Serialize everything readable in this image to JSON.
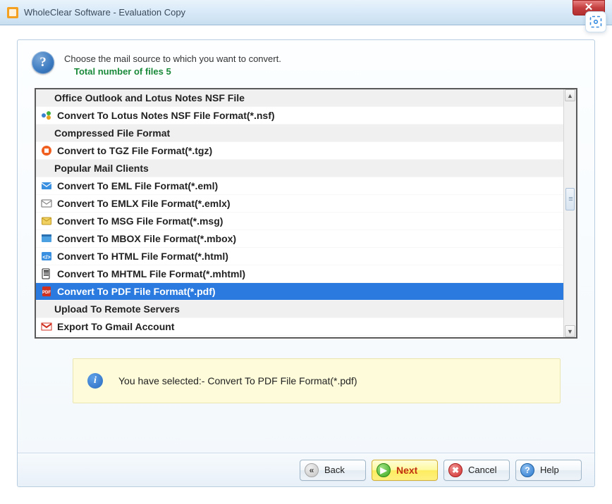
{
  "window": {
    "title": "WholeClear Software - Evaluation Copy",
    "close_glyph": "✕"
  },
  "instruction": {
    "line1": "Choose the mail source to which you want to convert.",
    "line2": "Total number of files 5",
    "help_glyph": "?"
  },
  "snip_glyph": "⎙",
  "list": {
    "rows": [
      {
        "kind": "header",
        "label": "Office Outlook and Lotus Notes NSF File"
      },
      {
        "kind": "item",
        "icon": "nsf-icon",
        "label": "Convert To Lotus Notes NSF File Format(*.nsf)"
      },
      {
        "kind": "header",
        "label": "Compressed File Format"
      },
      {
        "kind": "item",
        "icon": "tgz-icon",
        "label": "Convert to TGZ File Format(*.tgz)"
      },
      {
        "kind": "header",
        "label": "Popular Mail Clients"
      },
      {
        "kind": "item",
        "icon": "eml-icon",
        "label": "Convert To EML File Format(*.eml)"
      },
      {
        "kind": "item",
        "icon": "emlx-icon",
        "label": "Convert To EMLX File Format(*.emlx)"
      },
      {
        "kind": "item",
        "icon": "msg-icon",
        "label": "Convert To MSG File Format(*.msg)"
      },
      {
        "kind": "item",
        "icon": "mbox-icon",
        "label": "Convert To MBOX File Format(*.mbox)"
      },
      {
        "kind": "item",
        "icon": "html-icon",
        "label": "Convert To HTML File Format(*.html)"
      },
      {
        "kind": "item",
        "icon": "mhtml-icon",
        "label": "Convert To MHTML File Format(*.mhtml)"
      },
      {
        "kind": "item",
        "icon": "pdf-icon",
        "label": "Convert To PDF File Format(*.pdf)",
        "selected": true
      },
      {
        "kind": "header",
        "label": "Upload To Remote Servers"
      },
      {
        "kind": "item",
        "icon": "gmail-icon",
        "label": "Export To Gmail Account"
      }
    ]
  },
  "info": {
    "glyph": "i",
    "text": "You have selected:- Convert To PDF File Format(*.pdf)"
  },
  "buttons": {
    "back": "Back",
    "next": "Next",
    "cancel": "Cancel",
    "help": "Help",
    "back_glyph": "«",
    "next_glyph": "▶",
    "cancel_glyph": "✖",
    "help_glyph": "?"
  },
  "scroll": {
    "up_glyph": "▲",
    "down_glyph": "▼",
    "thumb_glyph": "≡"
  }
}
